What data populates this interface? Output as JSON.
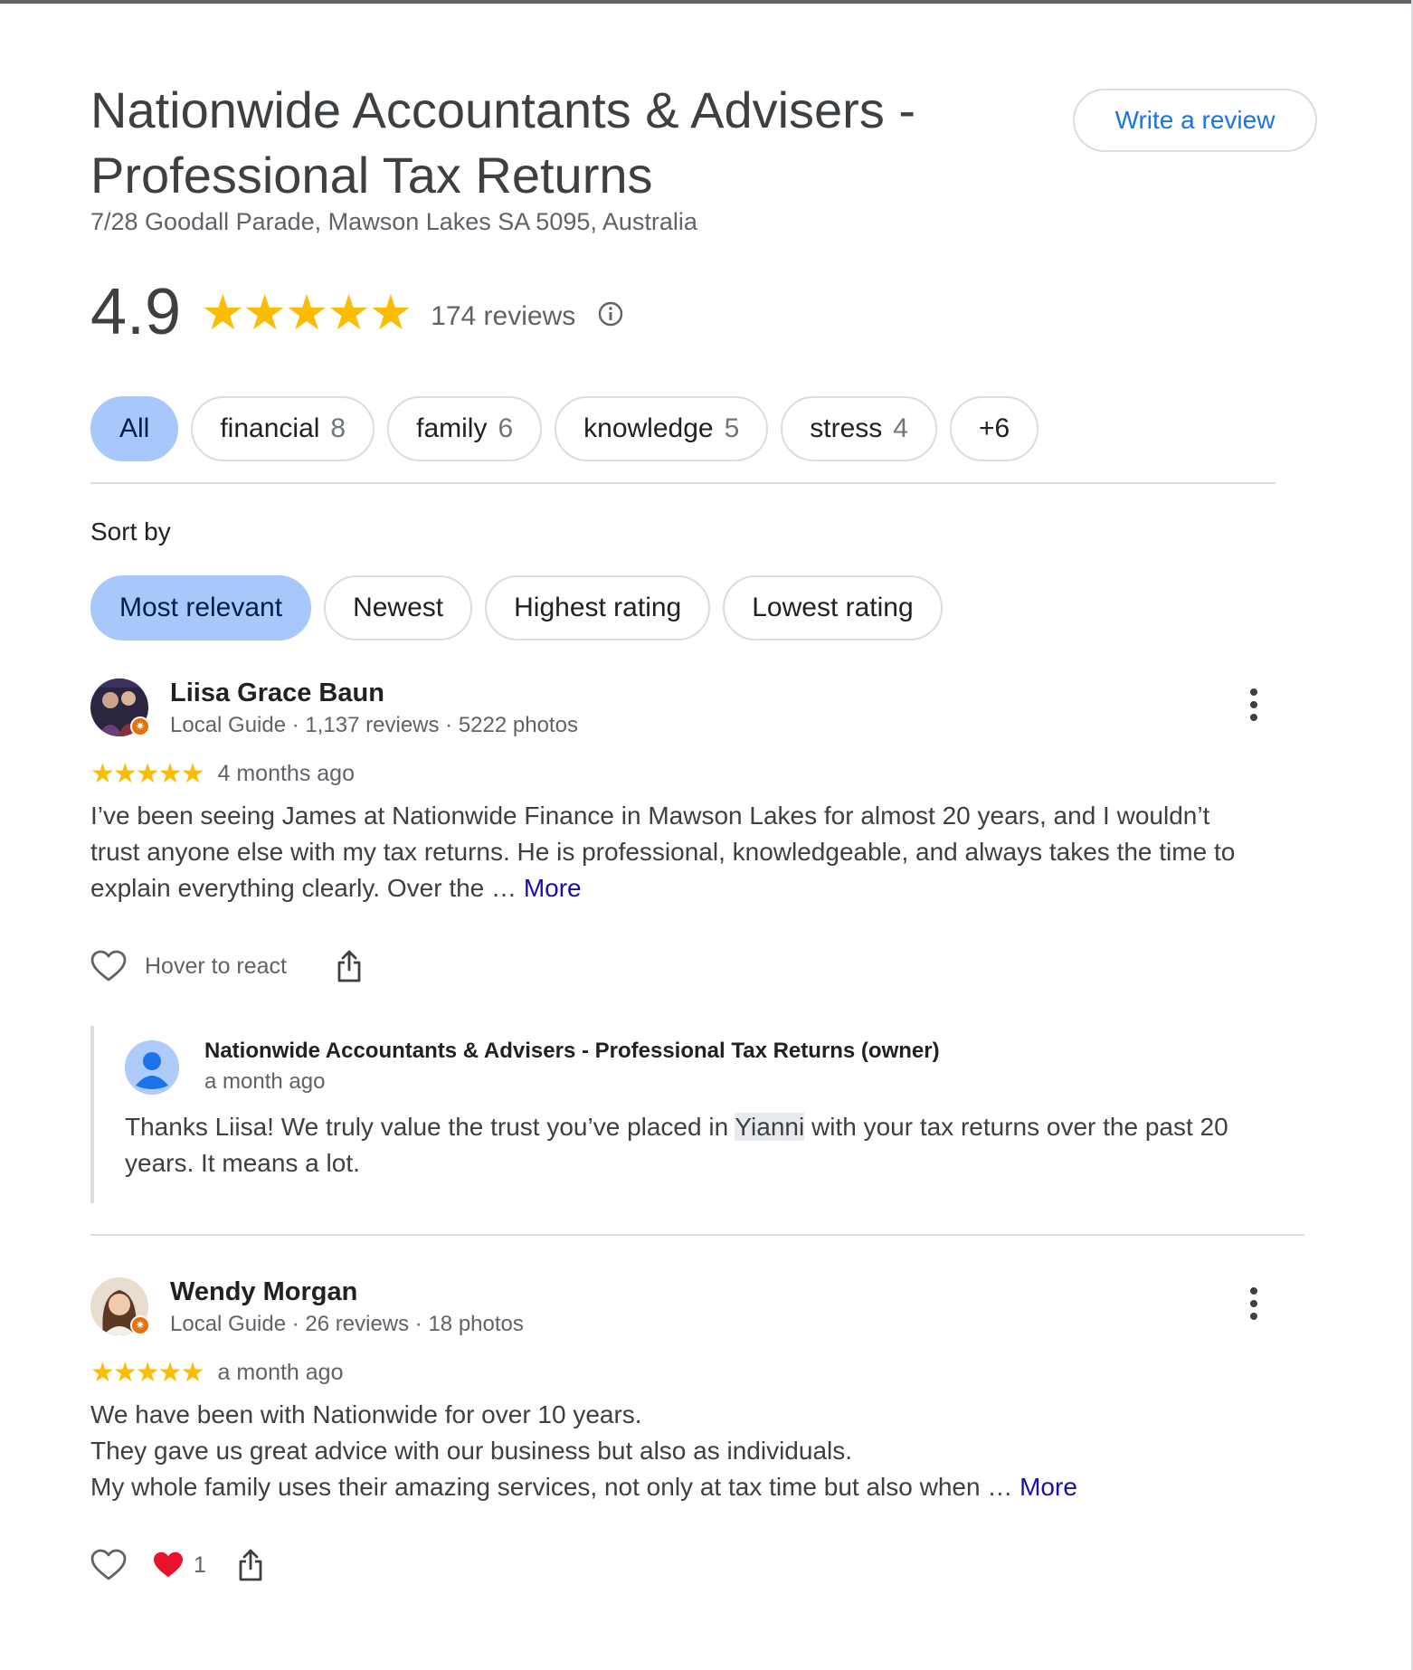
{
  "business": {
    "title": "Nationwide Accountants & Advisers - Professional Tax Returns",
    "address": "7/28 Goodall Parade, Mawson Lakes SA 5095, Australia",
    "write_review_label": "Write a review"
  },
  "rating": {
    "value": "4.9",
    "stars": "★★★★★",
    "reviews_label": "174 reviews",
    "info_icon": "info-icon"
  },
  "topics": [
    {
      "label": "All",
      "count": "",
      "active": true
    },
    {
      "label": "financial",
      "count": "8"
    },
    {
      "label": "family",
      "count": "6"
    },
    {
      "label": "knowledge",
      "count": "5"
    },
    {
      "label": "stress",
      "count": "4"
    },
    {
      "label": "+6",
      "count": ""
    }
  ],
  "sort": {
    "label": "Sort by",
    "options": [
      {
        "label": "Most relevant",
        "active": true
      },
      {
        "label": "Newest"
      },
      {
        "label": "Highest rating"
      },
      {
        "label": "Lowest rating"
      }
    ]
  },
  "reviews": [
    {
      "author": "Liisa Grace Baun",
      "meta": "Local Guide · 1,137 reviews · 5222 photos",
      "stars": "★★★★★",
      "ago": "4 months ago",
      "text_lines": [
        "I’ve been seeing James at Nationwide Finance in Mawson Lakes for almost 20 years, and I wouldn’t",
        "trust anyone else with my tax returns. He is professional, knowledgeable, and always takes the time to",
        "explain everything clearly. Over the … "
      ],
      "more_label": "More",
      "react_label": "Hover to react",
      "owner_reply": {
        "name": "Nationwide Accountants & Advisers - Professional Tax Returns (owner)",
        "ago": "a month ago",
        "text_before": "Thanks Liisa! We truly value the trust you’ve placed in ",
        "text_highlight": "Yianni",
        "text_after": " with your tax returns over the past 20",
        "text_line2": "years. It means a lot."
      }
    },
    {
      "author": "Wendy Morgan",
      "meta": "Local Guide · 26 reviews · 18 photos",
      "stars": "★★★★★",
      "ago": "a month ago",
      "text_lines": [
        "We have been with Nationwide for over 10 years.",
        "They gave us great advice with our business but also as individuals.",
        "My whole family uses their amazing services, not only at tax time but also when … "
      ],
      "more_label": "More",
      "reaction_count": "1"
    }
  ],
  "colors": {
    "accent": "#1a73e8",
    "chip_active": "#a8c7fa",
    "star": "#fbbc04",
    "link": "#1a0dab",
    "heart_red": "#e8132b"
  }
}
